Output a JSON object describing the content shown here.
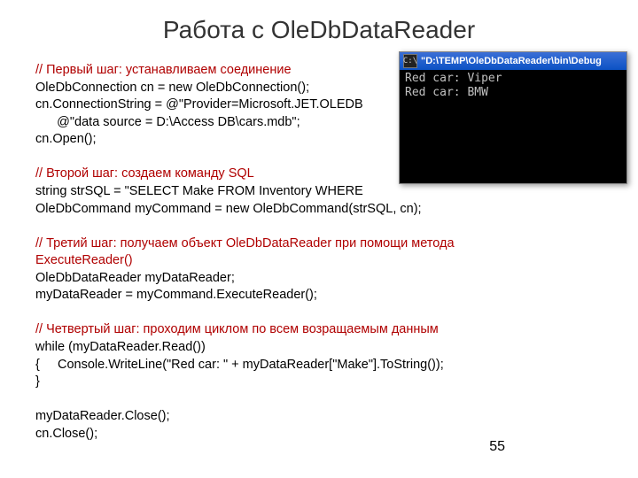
{
  "title": "Работа с OleDbDataReader",
  "code": {
    "c1": "// Первый шаг: устанавливаем соединение",
    "l1": "OleDbConnection cn = new OleDbConnection();",
    "l2a": "cn.ConnectionString = @\"Provider=Microsoft.JET.OLEDB",
    "l2b": "      @\"data source = D:\\Access DB\\cars.mdb\";",
    "l3": "cn.Open();",
    "blank1": "",
    "c2": "// Второй шаг: создаем команду SQL",
    "l4": "string strSQL = \"SELECT Make FROM Inventory WHERE",
    "l5": "OleDbCommand myCommand = new OleDbCommand(strSQL, cn);",
    "blank2": "",
    "c3": "// Третий шаг: получаем объект OleDbDataReader при помощи метода",
    "c3b": "ExecuteReader()",
    "l6": "OleDbDataReader myDataReader;",
    "l7": "myDataReader = myCommand.ExecuteReader();",
    "blank3": "",
    "c4": "// Четвертый шаг: проходим циклом по всем возращаемым данным",
    "l8": "while (myDataReader.Read())",
    "l9": "{     Console.WriteLine(\"Red car: \" + myDataReader[\"Make\"].ToString());",
    "l10": "}",
    "blank4": "",
    "l11": "myDataReader.Close();",
    "l12": "cn.Close();"
  },
  "console": {
    "icon": "C:\\",
    "path": "\"D:\\TEMP\\OleDbDataReader\\bin\\Debug",
    "line1": "Red car: Viper",
    "line2": "Red car: BMW"
  },
  "page": "55"
}
